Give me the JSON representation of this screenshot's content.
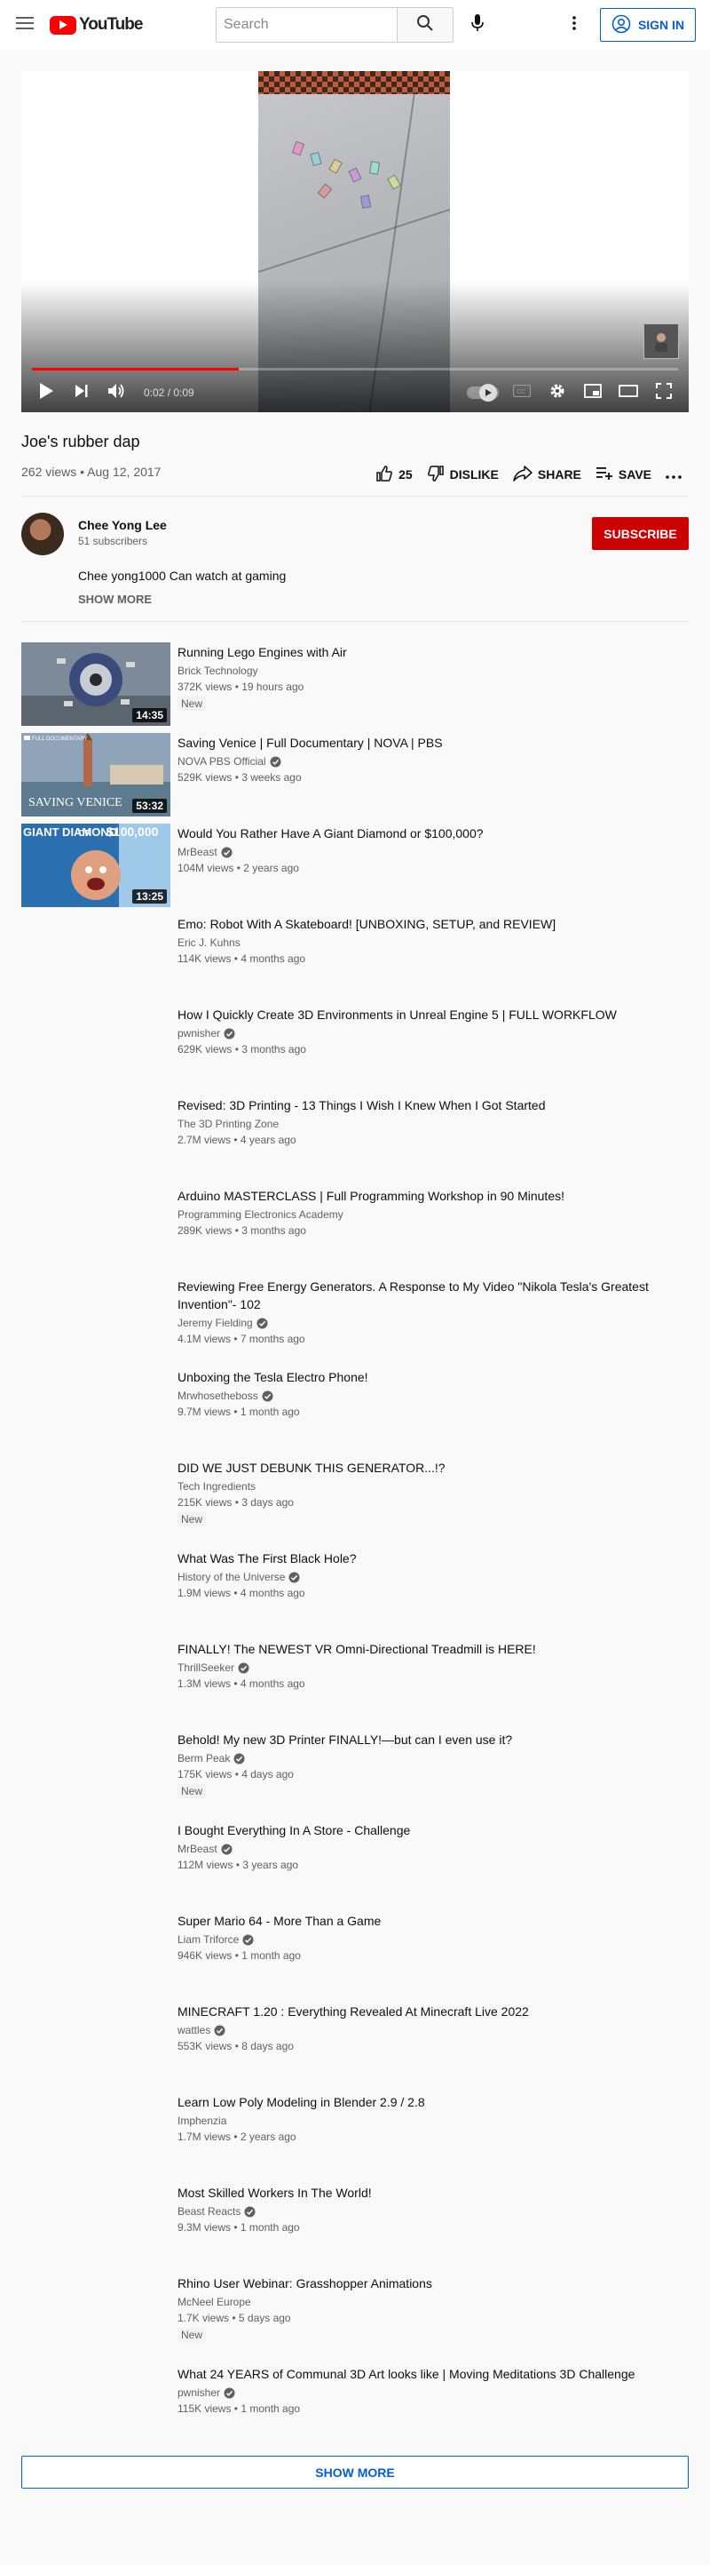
{
  "header": {
    "logo_text": "YouTube",
    "search_placeholder": "Search",
    "signin_label": "SIGN IN"
  },
  "player": {
    "time_current": "0:02",
    "time_total": "0:09",
    "progress_fraction": 0.32
  },
  "video": {
    "title": "Joe's rubber dap",
    "meta": "262 views • Aug 12, 2017",
    "likes": "25",
    "dislike_label": "DISLIKE",
    "share_label": "SHARE",
    "save_label": "SAVE"
  },
  "channel": {
    "name": "Chee Yong Lee",
    "subscribers": "51 subscribers",
    "subscribe_label": "SUBSCRIBE",
    "description": "Chee yong1000 Can watch at gaming",
    "show_more_label": "SHOW MORE"
  },
  "related": [
    {
      "title": "Running Lego Engines with Air",
      "channel": "Brick Technology",
      "verified": false,
      "meta": "372K views • 19 hours ago",
      "badge": "New",
      "duration": "14:35",
      "thumb": "lego"
    },
    {
      "title": "Saving Venice | Full Documentary | NOVA | PBS",
      "channel": "NOVA PBS Official",
      "verified": true,
      "meta": "529K views • 3 weeks ago",
      "badge": "",
      "duration": "53:32",
      "thumb": "venice",
      "thumb_text_top": "FULL DOCUMENTARY",
      "thumb_text": "SAVING VENICE"
    },
    {
      "title": "Would You Rather Have A Giant Diamond or $100,000?",
      "channel": "MrBeast",
      "verified": true,
      "meta": "104M views • 2 years ago",
      "badge": "",
      "duration": "13:25",
      "thumb": "diamond",
      "thumb_text_left": "GIANT DIAMOND",
      "thumb_text_or": "OR",
      "thumb_text_right": "$100,000"
    },
    {
      "title": "Emo: Robot With A Skateboard! [UNBOXING, SETUP, and REVIEW]",
      "channel": "Eric J. Kuhns",
      "verified": false,
      "meta": "114K views • 4 months ago",
      "badge": ""
    },
    {
      "title": "How I Quickly Create 3D Environments in Unreal Engine 5 | FULL WORKFLOW",
      "channel": "pwnisher",
      "verified": true,
      "meta": "629K views • 3 months ago",
      "badge": ""
    },
    {
      "title": "Revised: 3D Printing - 13 Things I Wish I Knew When I Got Started",
      "channel": "The 3D Printing Zone",
      "verified": false,
      "meta": "2.7M views • 4 years ago",
      "badge": ""
    },
    {
      "title": "Arduino MASTERCLASS | Full Programming Workshop in 90 Minutes!",
      "channel": "Programming Electronics Academy",
      "verified": false,
      "meta": "289K views • 3 months ago",
      "badge": ""
    },
    {
      "title": "Reviewing Free Energy Generators. A Response to My Video \"Nikola Tesla's Greatest Invention\"- 102",
      "channel": "Jeremy Fielding",
      "verified": true,
      "meta": "4.1M views • 7 months ago",
      "badge": ""
    },
    {
      "title": "Unboxing the Tesla Electro Phone!",
      "channel": "Mrwhosetheboss",
      "verified": true,
      "meta": "9.7M views • 1 month ago",
      "badge": ""
    },
    {
      "title": "DID WE JUST DEBUNK THIS GENERATOR...!?",
      "channel": "Tech Ingredients",
      "verified": false,
      "meta": "215K views • 3 days ago",
      "badge": "New"
    },
    {
      "title": "What Was The First Black Hole?",
      "channel": "History of the Universe",
      "verified": true,
      "meta": "1.9M views • 4 months ago",
      "badge": ""
    },
    {
      "title": "FINALLY! The NEWEST VR Omni-Directional Treadmill is HERE!",
      "channel": "ThrillSeeker",
      "verified": true,
      "meta": "1.3M views • 4 months ago",
      "badge": ""
    },
    {
      "title": "Behold! My new 3D Printer FINALLY!—but can I even use it?",
      "channel": "Berm Peak",
      "verified": true,
      "meta": "175K views • 4 days ago",
      "badge": "New"
    },
    {
      "title": "I Bought Everything In A Store - Challenge",
      "channel": "MrBeast",
      "verified": true,
      "meta": "112M views • 3 years ago",
      "badge": ""
    },
    {
      "title": "Super Mario 64 - More Than a Game",
      "channel": "Liam Triforce",
      "verified": true,
      "meta": "946K views • 1 month ago",
      "badge": ""
    },
    {
      "title": "MINECRAFT 1.20 : Everything Revealed At Minecraft Live 2022",
      "channel": "wattles",
      "verified": true,
      "meta": "553K views • 8 days ago",
      "badge": ""
    },
    {
      "title": "Learn Low Poly Modeling in Blender 2.9 / 2.8",
      "channel": "Imphenzia",
      "verified": false,
      "meta": "1.7M views • 2 years ago",
      "badge": ""
    },
    {
      "title": "Most Skilled Workers In The World!",
      "channel": "Beast Reacts",
      "verified": true,
      "meta": "9.3M views • 1 month ago",
      "badge": ""
    },
    {
      "title": "Rhino User Webinar: Grasshopper Animations",
      "channel": "McNeel Europe",
      "verified": false,
      "meta": "1.7K views • 5 days ago",
      "badge": "New"
    },
    {
      "title": "What 24 YEARS of Communal 3D Art looks like | Moving Meditations 3D Challenge",
      "channel": "pwnisher",
      "verified": true,
      "meta": "115K views • 1 month ago",
      "badge": ""
    }
  ],
  "show_more_label": "SHOW MORE",
  "colors": {
    "brand_red": "#ff0000",
    "subscribe_red": "#cc0000",
    "link_blue": "#065fd4",
    "progress_red": "#ff0000"
  }
}
